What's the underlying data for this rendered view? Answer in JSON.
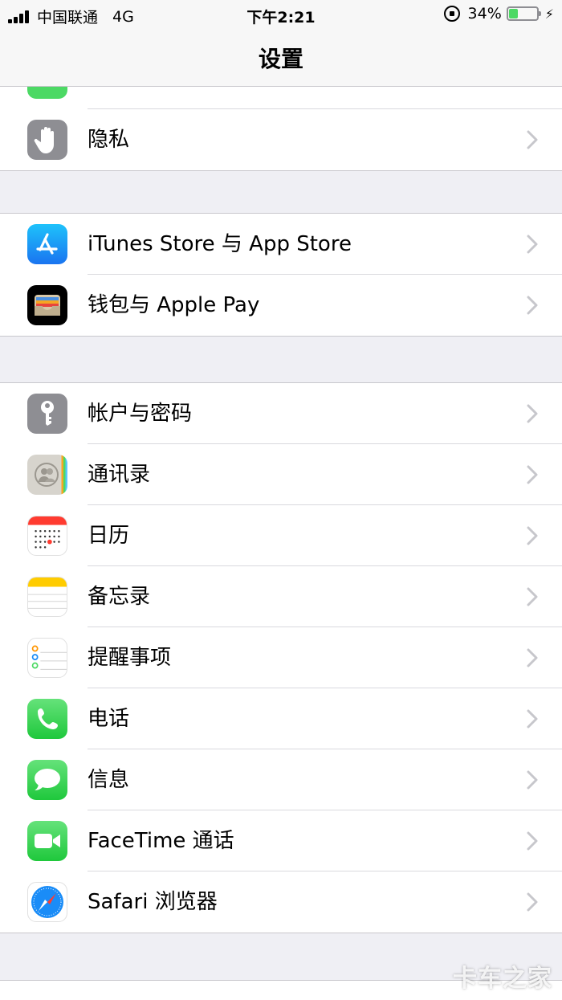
{
  "status": {
    "carrier": "中国联通",
    "network": "4G",
    "time": "下午2:21",
    "battery": "34%",
    "battery_level": 0.34
  },
  "nav": {
    "title": "设置"
  },
  "groups": [
    {
      "items": [
        {
          "label": "隐私",
          "icon": "privacy-hand-icon",
          "color": "#8e8e93"
        }
      ]
    },
    {
      "items": [
        {
          "label": "iTunes Store 与 App Store",
          "icon": "app-store-icon",
          "color": "#1a8cf7"
        },
        {
          "label": "钱包与 Apple Pay",
          "icon": "wallet-icon",
          "color": "#000000"
        }
      ]
    },
    {
      "items": [
        {
          "label": "帐户与密码",
          "icon": "key-icon",
          "color": "#8e8e93"
        },
        {
          "label": "通讯录",
          "icon": "contacts-icon",
          "color": "#c9c6bf"
        },
        {
          "label": "日历",
          "icon": "calendar-icon",
          "color": "#ff3b30"
        },
        {
          "label": "备忘录",
          "icon": "notes-icon",
          "color": "#ffcc00"
        },
        {
          "label": "提醒事项",
          "icon": "reminders-icon",
          "color": "#ffffff"
        },
        {
          "label": "电话",
          "icon": "phone-icon",
          "color": "#4cd964"
        },
        {
          "label": "信息",
          "icon": "messages-icon",
          "color": "#4cd964"
        },
        {
          "label": "FaceTime 通话",
          "icon": "facetime-icon",
          "color": "#4cd964"
        },
        {
          "label": "Safari 浏览器",
          "icon": "safari-icon",
          "color": "#1a8cf7"
        }
      ]
    }
  ],
  "watermark": "卡车之家"
}
